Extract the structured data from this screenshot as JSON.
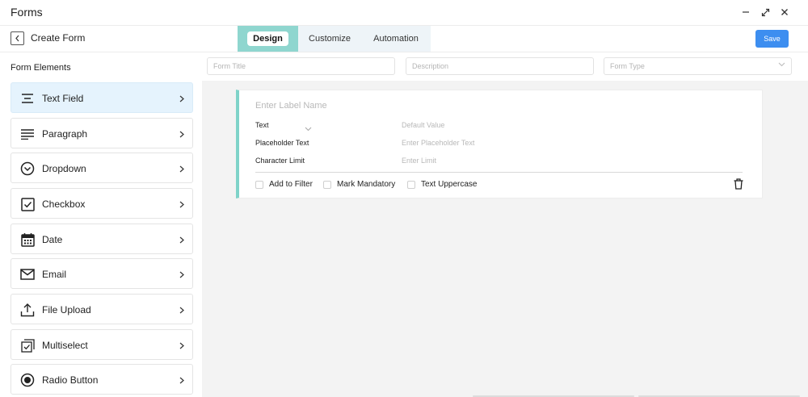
{
  "window": {
    "title": "Forms"
  },
  "header": {
    "title": "Create Form",
    "tabs": [
      {
        "label": "Design",
        "active": true
      },
      {
        "label": "Customize",
        "active": false
      },
      {
        "label": "Automation",
        "active": false
      }
    ],
    "save_label": "Save"
  },
  "sidebar": {
    "heading": "Form Elements",
    "items": [
      {
        "label": "Text Field",
        "icon": "text-field-icon",
        "active": true
      },
      {
        "label": "Paragraph",
        "icon": "paragraph-icon",
        "active": false
      },
      {
        "label": "Dropdown",
        "icon": "dropdown-icon",
        "active": false
      },
      {
        "label": "Checkbox",
        "icon": "checkbox-icon",
        "active": false
      },
      {
        "label": "Date",
        "icon": "calendar-icon",
        "active": false
      },
      {
        "label": "Email",
        "icon": "envelope-icon",
        "active": false
      },
      {
        "label": "File Upload",
        "icon": "upload-icon",
        "active": false
      },
      {
        "label": "Multiselect",
        "icon": "multiselect-icon",
        "active": false
      },
      {
        "label": "Radio Button",
        "icon": "radio-icon",
        "active": false
      }
    ]
  },
  "form_inputs": {
    "title_placeholder": "Form Title",
    "description_placeholder": "Description",
    "type_placeholder": "Form Type"
  },
  "field_card": {
    "label_placeholder": "Enter Label Name",
    "type_value": "Text",
    "default_value_placeholder": "Default Value",
    "placeholder_label": "Placeholder Text",
    "placeholder_value_placeholder": "Enter Placeholder Text",
    "char_limit_label": "Character Limit",
    "char_limit_placeholder": "Enter Limit",
    "options": [
      {
        "label": "Add to Filter",
        "checked": false
      },
      {
        "label": "Mark Mandatory",
        "checked": false
      },
      {
        "label": "Text Uppercase",
        "checked": false
      }
    ]
  },
  "colors": {
    "accent_teal": "#8fd6cf",
    "save_blue": "#3d8ef0",
    "active_item_bg": "#e5f3fd",
    "canvas_bg": "#f3f3f3"
  }
}
